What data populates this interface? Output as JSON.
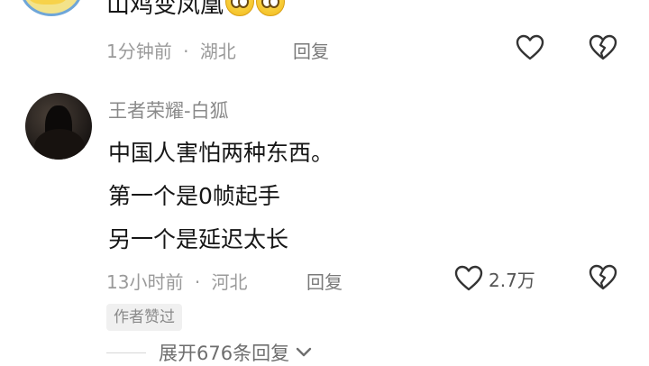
{
  "prev_comment": {
    "text": "山鸡变凤凰",
    "emojis": [
      "flushed-face",
      "flushed-face"
    ],
    "time": "1分钟前",
    "separator": "·",
    "location": "湖北",
    "reply_label": "回复"
  },
  "comment": {
    "username": "王者荣耀-白狐",
    "lines": [
      "中国人害怕两种东西。",
      "第一个是0帧起手",
      "另一个是延迟太长"
    ],
    "time": "13小时前",
    "separator": "·",
    "location": "河北",
    "reply_label": "回复",
    "like_count": "2.7万",
    "author_badge": "作者赞过",
    "expand_label": "展开676条回复"
  },
  "icons": {
    "like": "heart-outline-icon",
    "dislike": "broken-heart-icon",
    "expand": "chevron-down-icon"
  }
}
